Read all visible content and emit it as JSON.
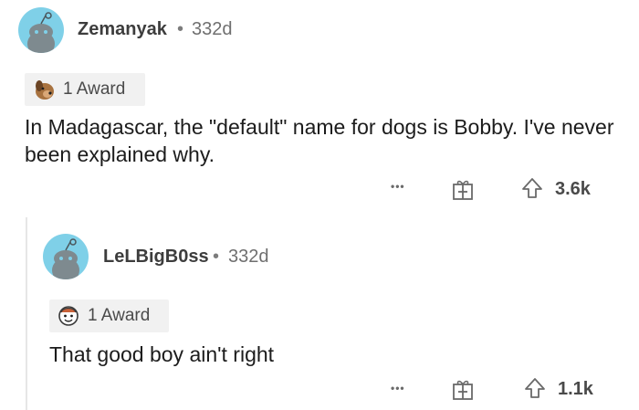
{
  "comments": [
    {
      "username": "Zemanyak",
      "separator": "•",
      "age": "332d",
      "award_label": "1 Award",
      "award_icon": "dog-award-icon",
      "body": "In Madagascar, the \"default\" name for dogs is Bobby. I've never been explained why.",
      "more_label": "•••",
      "votes": "3.6k"
    },
    {
      "username": "LeLBigB0ss",
      "separator": "•",
      "age": "332d",
      "award_label": "1 Award",
      "award_icon": "wholesome-award-icon",
      "body": "That good boy ain't right",
      "more_label": "•••",
      "votes": "1.1k"
    }
  ],
  "colors": {
    "avatar_bg": "#7fd0e8",
    "award_bg": "#f1f1f1",
    "thread_line": "#e6e6e6"
  }
}
